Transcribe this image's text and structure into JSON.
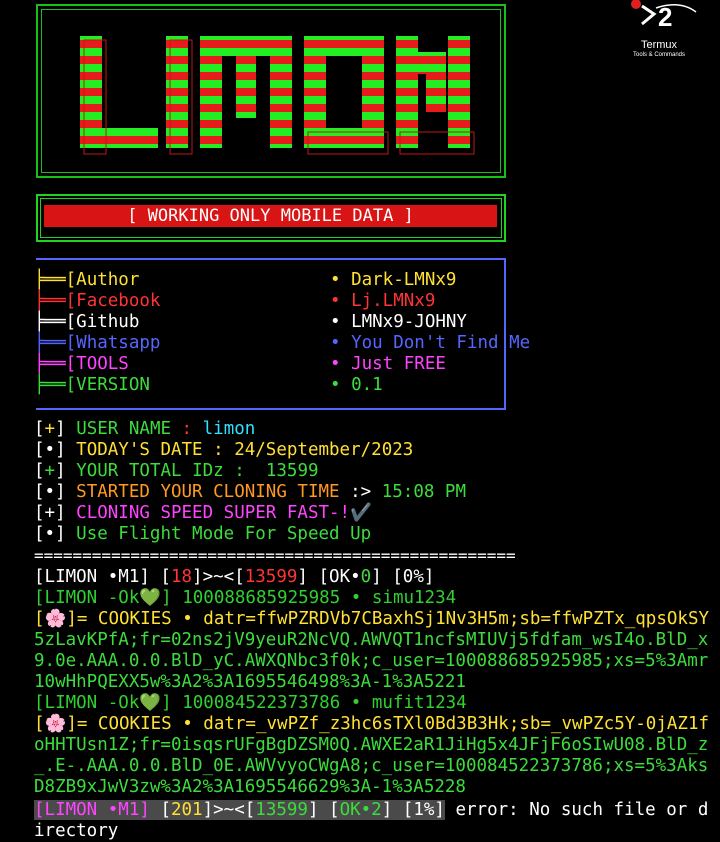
{
  "logo": {
    "text": "LIMON",
    "watermark": "Termux",
    "watermark_sub": "Tools & Commands"
  },
  "banner": "[ WORKING ONLY MOBILE DATA ]",
  "info": [
    {
      "prefix": "╞══[",
      "key": "Author",
      "val": "Dark-LMNx9",
      "color": "y"
    },
    {
      "prefix": "╞══[",
      "key": "Facebook",
      "val": "Lj.LMNx9",
      "color": "r"
    },
    {
      "prefix": "╞══[",
      "key": "Github",
      "val": "LMNx9-JOHNY",
      "color": "w"
    },
    {
      "prefix": "╞══[",
      "key": "Whatsapp",
      "val": "You Don't Find Me",
      "color": "b"
    },
    {
      "prefix": "╞══[",
      "key": "TOOLS",
      "val": "Just FREE",
      "color": "m"
    },
    {
      "prefix": "╞══[",
      "key": "VERSION",
      "val": "0.1",
      "color": "g"
    }
  ],
  "status": {
    "user_label": "USER NAME",
    "user_sep": " : ",
    "user": "limon",
    "date_label": "TODAY'S DATE",
    "date": " : 24/September/2023",
    "ids_label": "YOUR TOTAL IDz :",
    "ids": "  13599",
    "time_label": "STARTED YOUR CLONING TIME",
    "time_sep": " :> ",
    "time": "15:08 PM",
    "speed": "CLONING SPEED SUPER FAST-!✔️",
    "tip": "Use Flight Mode For Speed Up"
  },
  "separator": "==================================================",
  "progress1": {
    "a": "[LIMON •M1] [",
    "n": "18",
    "b": "]>~<[",
    "total": "13599",
    "c": "] [OK•",
    "ok": "0",
    "d": "] [0%]"
  },
  "results": [
    {
      "ok_line": "[LIMON -Ok💚] 100088685925985 • simu1234",
      "cookie_lines": [
        "[🌸]= COOKIES • datr=ffwPZRDVb7CBaxhSj1Nv3H5m;sb=ffwPZTx_qpsOkSY",
        "5zLavKPfA;fr=02ns2jV9yeuR2NcVQ.AWVQT1ncfsMIUVj5fdfam_wsI4o.BlD_x",
        "9.0e.AAA.0.0.BlD_yC.AWXQNbc3f0k;c_user=100088685925985;xs=5%3Amr",
        "10wHhPQEXX5w%3A2%3A1695546498%3A-1%3A5221"
      ]
    },
    {
      "ok_line": "[LIMON -Ok💚] 100084522373786 • mufit1234",
      "cookie_lines": [
        "[🌸]= COOKIES • datr=_vwPZf_z3hc6sTXl0Bd3B3Hk;sb=_vwPZc5Y-0jAZ1f",
        "oHHTUsn1Z;fr=0isqsrUFgBgDZSM0Q.AWXE2aR1JiHg5x4JFjF6oSIwU08.BlD_z",
        "_.E-.AAA.0.0.BlD_0E.AWVvyoCWgA8;c_user=100084522373786;xs=5%3Aks",
        "D8ZB9xJwV3zw%3A2%3A1695546629%3A-1%3A5228"
      ]
    }
  ],
  "progress2": {
    "a": "[LIMON •M1]",
    "b": " [",
    "n": "201",
    "c": "]>~<[",
    "total": "13599",
    "d": "] [",
    "ok": "OK•2",
    "e": "] [1%]",
    "err": " error: No such file or d",
    "err2": "irectory"
  },
  "colors": {
    "bg": "#000000",
    "green": "#3ddc3d",
    "red": "#ff3434",
    "banner": "#d81414"
  }
}
